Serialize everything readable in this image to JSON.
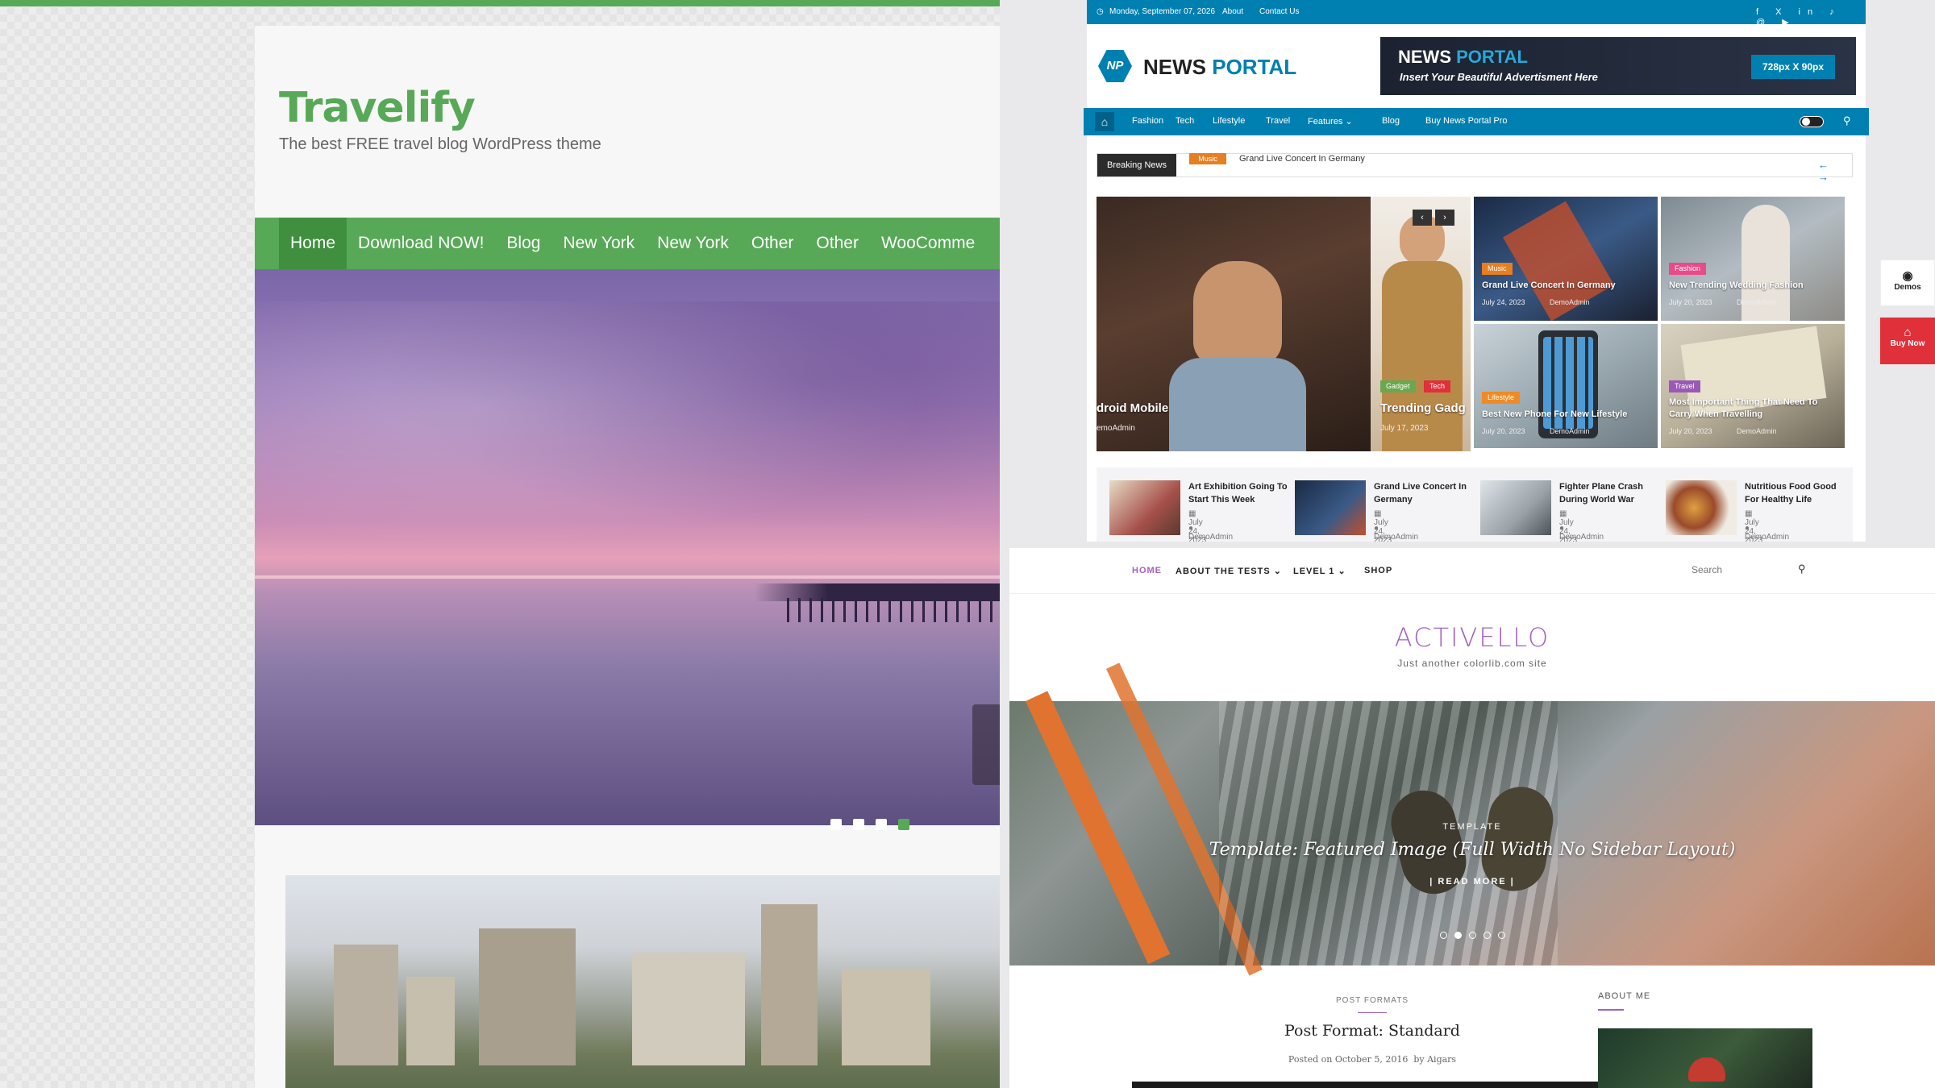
{
  "travelify": {
    "title": "Travelify",
    "tagline": "The best FREE travel blog WordPress theme",
    "nav": [
      "Home",
      "Download NOW!",
      "Blog",
      "New York",
      "New York",
      "Other",
      "Other",
      "WooComme"
    ],
    "slider": {
      "active_dot": 4,
      "dot_count": 4
    },
    "colors": {
      "accent": "#57a957"
    }
  },
  "newsportal": {
    "topbar": {
      "date": "Monday, September 07, 2026",
      "about": "About",
      "contact": "Contact Us",
      "social_icons": [
        "facebook-icon",
        "x-icon",
        "linkedin-icon",
        "tiktok-icon",
        "threads-icon",
        "youtube-icon"
      ]
    },
    "logo": {
      "part1": "NEWS",
      "part2": "PORTAL",
      "mark": "NP"
    },
    "ad": {
      "line1_a": "NEWS",
      "line1_b": "PORTAL",
      "line2": "Insert Your Beautiful Advertisment Here",
      "size": "728px X 90px"
    },
    "nav": [
      "Fashion",
      "Tech",
      "Lifestyle",
      "Travel",
      "Features",
      "Blog",
      "Buy News Portal Pro"
    ],
    "ticker": {
      "label": "Breaking News",
      "tag": "Music",
      "headline": "Grand Live Concert In Germany"
    },
    "cards": {
      "big": {
        "title": "droid Mobile",
        "author": "emoAdmin"
      },
      "tall": {
        "tags": [
          "Gadget",
          "Tech"
        ],
        "title": "Trending Gadg",
        "date": "July 17, 2023"
      },
      "c1": {
        "tag": "Music",
        "title": "Grand Live Concert In Germany",
        "date": "July 24, 2023",
        "author": "DemoAdmin"
      },
      "c2": {
        "tag": "Fashion",
        "title": "New Trending Wedding Fashion",
        "date": "July 20, 2023",
        "author": "DemoAdmin"
      },
      "c3": {
        "tag": "Lifestyle",
        "title": "Best New Phone For New Lifestyle",
        "date": "July 20, 2023",
        "author": "DemoAdmin"
      },
      "c4": {
        "tag": "Travel",
        "title": "Most Important Thing That Need To Carry When Travelling",
        "date": "July 20, 2023",
        "author": "DemoAdmin"
      }
    },
    "strip": [
      {
        "title": "Art Exhibition Going To Start This Week",
        "date": "July 24, 2023",
        "author": "DemoAdmin"
      },
      {
        "title": "Grand Live Concert In Germany",
        "date": "July 24, 2023",
        "author": "DemoAdmin"
      },
      {
        "title": "Fighter Plane Crash During World War",
        "date": "July 24, 2023",
        "author": "DemoAdmin"
      },
      {
        "title": "Nutritious Food Good For Healthy Life",
        "date": "July 24, 2023",
        "author": "DemoAdmin"
      }
    ],
    "side": {
      "demos": "Demos",
      "buy": "Buy Now"
    },
    "colors": {
      "accent": "#0080b1",
      "music": "#e67e22",
      "fashion": "#e84a8a",
      "lifestyle": "#f08a24",
      "travel": "#9b59b6",
      "gadget": "#6aa84f",
      "tech": "#e0303a"
    }
  },
  "activello": {
    "nav": [
      "HOME",
      "ABOUT THE TESTS",
      "LEVEL 1",
      "SHOP"
    ],
    "search_placeholder": "Search",
    "title": "ACTIVELLO",
    "tagline": "Just another colorlib.com site",
    "hero": {
      "category": "TEMPLATE",
      "title": "Template: Featured Image (Full Width No Sidebar Layout)",
      "more": "READ MORE",
      "dot_count": 5
    },
    "post": {
      "category": "POST FORMATS",
      "title": "Post Format: Standard",
      "date_prefix": "Posted on",
      "date": "October 5, 2016",
      "by": "by",
      "author": "Aigars"
    },
    "sidebar": {
      "about": "ABOUT ME"
    },
    "colors": {
      "accent": "#a161bf"
    }
  }
}
